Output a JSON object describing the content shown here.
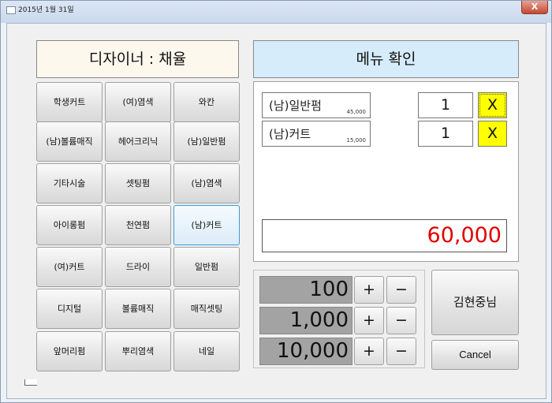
{
  "window": {
    "title": "2015년 1월 31일",
    "close_label": "X"
  },
  "designer": {
    "label": "디자이너 : 채율"
  },
  "services": [
    "학생커트",
    "(여)염색",
    "와칸",
    "(남)볼륨매직",
    "헤어크리닉",
    "(남)일반펌",
    "기타시술",
    "셋팅펌",
    "(남)염색",
    "아이롱펌",
    "천연펌",
    "(남)커트",
    "(여)커트",
    "드라이",
    "일반펌",
    "디지털",
    "볼륨매직",
    "매직셋팅",
    "앞머리펌",
    "뿌리염색",
    "네일"
  ],
  "menu": {
    "title": "메뉴 확인",
    "items": [
      {
        "name": "(남)일반펌",
        "price": "45,000",
        "qty": "1",
        "remove": "X"
      },
      {
        "name": "(남)커트",
        "price": "15,000",
        "qty": "1",
        "remove": "X"
      }
    ],
    "total": "60,000"
  },
  "amounts": [
    {
      "value": "100",
      "plus": "+",
      "minus": "−"
    },
    {
      "value": "1,000",
      "plus": "+",
      "minus": "−"
    },
    {
      "value": "10,000",
      "plus": "+",
      "minus": "−"
    }
  ],
  "customer": {
    "label": "김현중님"
  },
  "cancel_label": "Cancel",
  "colors": {
    "total_text": "#e00000",
    "remove_button": "#ffff00",
    "designer_bg": "#fdf8ee",
    "menu_title_bg": "#d6ecfb"
  }
}
